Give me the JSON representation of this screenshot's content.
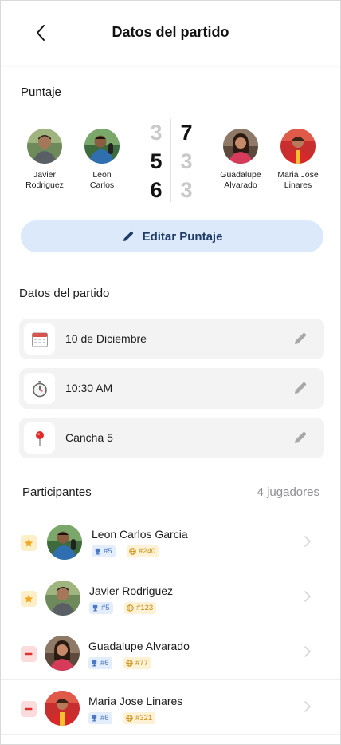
{
  "header": {
    "title": "Datos del partido"
  },
  "score_section": {
    "label": "Puntaje",
    "team_a": [
      {
        "name_line1": "Javier",
        "name_line2": "Rodriguez"
      },
      {
        "name_line1": "Leon",
        "name_line2": "Carlos"
      }
    ],
    "team_b": [
      {
        "name_line1": "Guadalupe",
        "name_line2": "Alvarado"
      },
      {
        "name_line1": "Maria Jose",
        "name_line2": "Linares"
      }
    ],
    "sets": [
      {
        "a": "3",
        "b": "7"
      },
      {
        "a": "5",
        "b": "3"
      },
      {
        "a": "6",
        "b": "3"
      }
    ],
    "edit_button": "Editar Puntaje"
  },
  "match_section": {
    "label": "Datos del partido",
    "date": "10 de Diciembre",
    "time": "10:30 AM",
    "court": "Cancha 5"
  },
  "participants_section": {
    "label": "Participantes",
    "count": "4 jugadores",
    "players": [
      {
        "name": "Leon Carlos Garcia",
        "rank": "#5",
        "world": "#240",
        "role": "captain"
      },
      {
        "name": "Javier Rodriguez",
        "rank": "#5",
        "world": "#123",
        "role": "captain"
      },
      {
        "name": "Guadalupe Alvarado",
        "rank": "#6",
        "world": "#77",
        "role": "removable"
      },
      {
        "name": "Maria Jose Linares",
        "rank": "#6",
        "world": "#321",
        "role": "removable"
      }
    ]
  },
  "colors": {
    "accent_bg": "#dce9fa",
    "accent_text": "#1e3a66",
    "captain_star": "#f5a623",
    "remove_red": "#e03131"
  }
}
